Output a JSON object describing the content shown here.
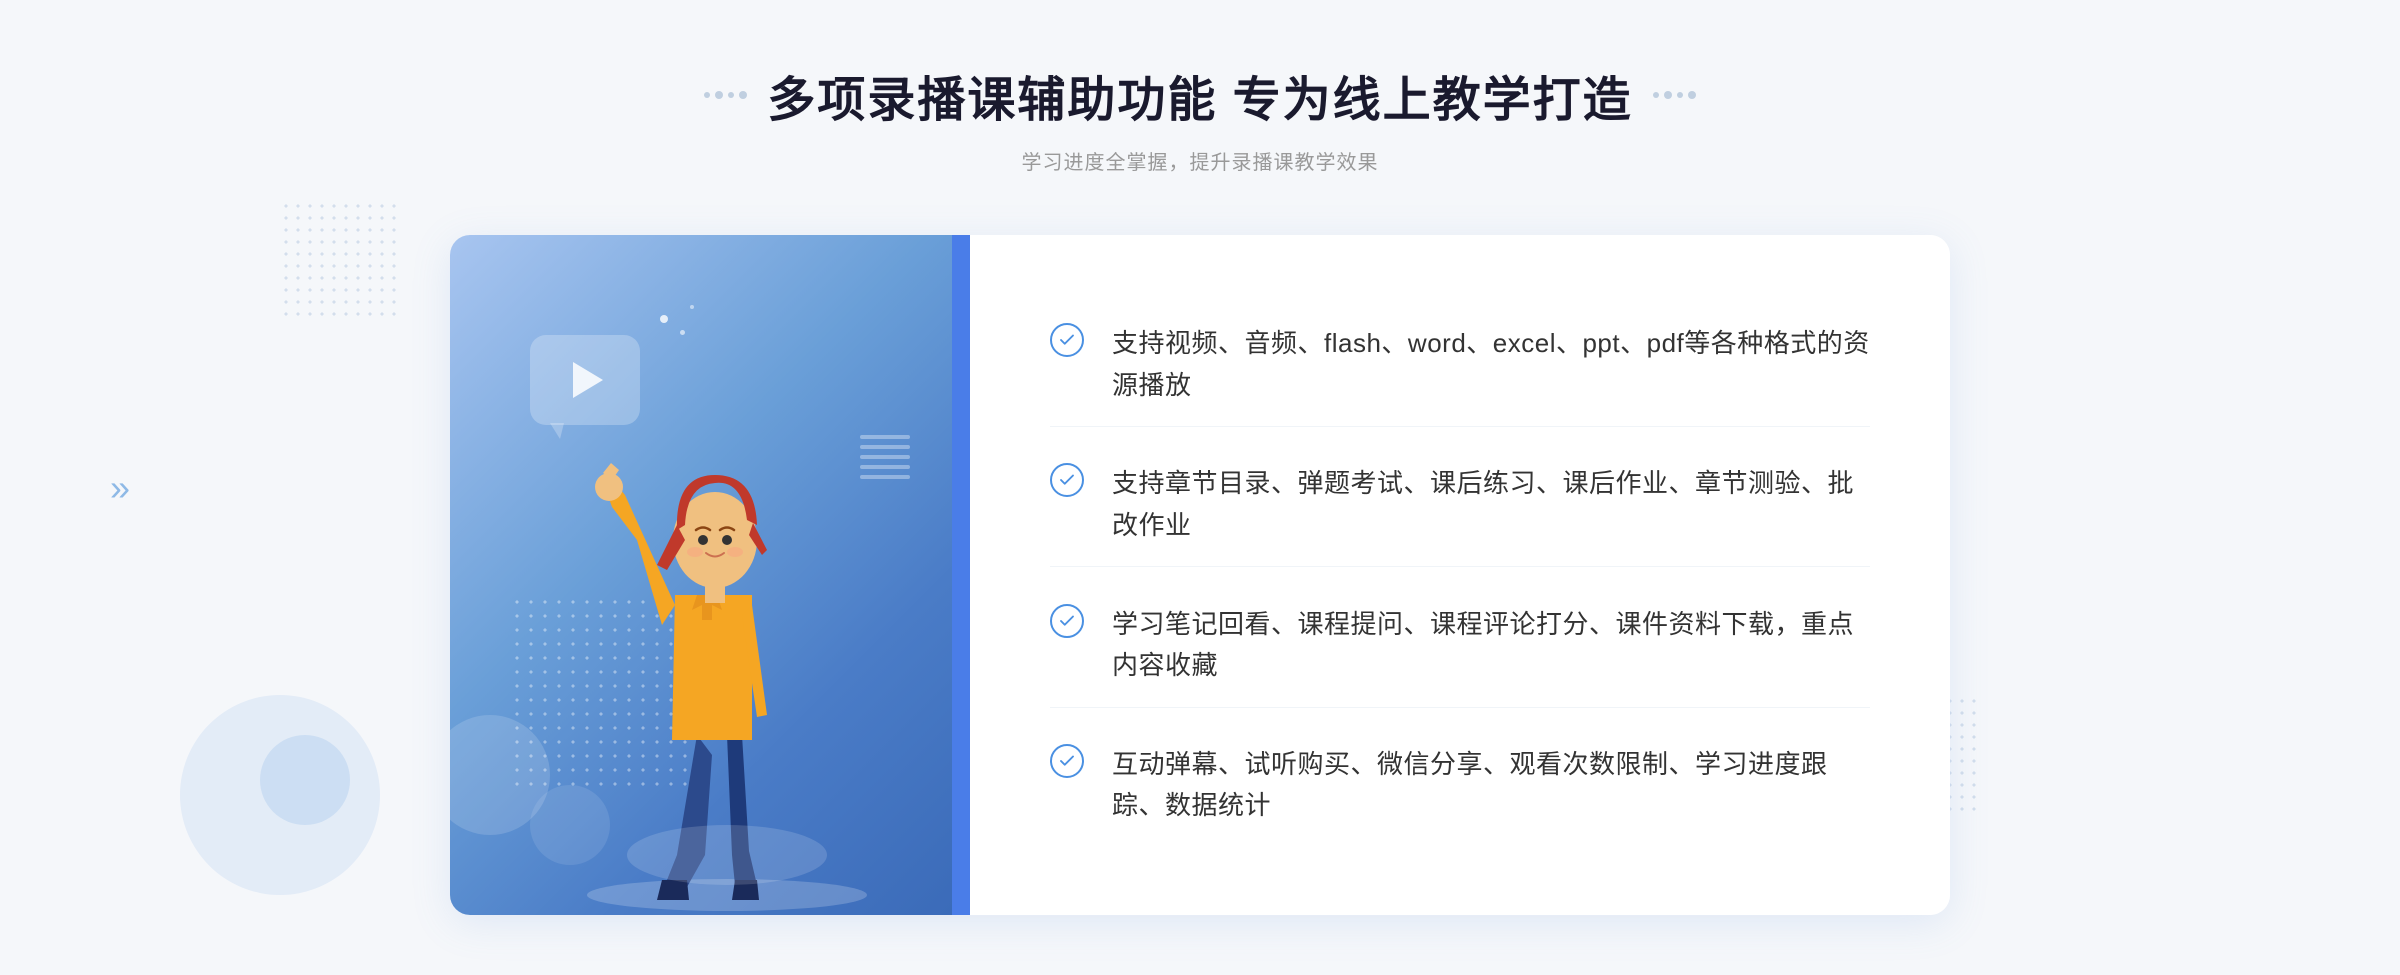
{
  "page": {
    "background_color": "#f5f7fa"
  },
  "header": {
    "title": "多项录播课辅助功能 专为线上教学打造",
    "subtitle": "学习进度全掌握，提升录播课教学效果"
  },
  "features": [
    {
      "id": 1,
      "text": "支持视频、音频、flash、word、excel、ppt、pdf等各种格式的资源播放"
    },
    {
      "id": 2,
      "text": "支持章节目录、弹题考试、课后练习、课后作业、章节测验、批改作业"
    },
    {
      "id": 3,
      "text": "学习笔记回看、课程提问、课程评论打分、课件资料下载，重点内容收藏"
    },
    {
      "id": 4,
      "text": "互动弹幕、试听购买、微信分享、观看次数限制、学习进度跟踪、数据统计"
    }
  ],
  "icons": {
    "check": "✓",
    "chevron_left": "»",
    "play": "▶"
  },
  "colors": {
    "primary_blue": "#4a90e2",
    "gradient_start": "#a8c5f0",
    "gradient_end": "#3a6ab8",
    "title_color": "#1a1a2e",
    "text_color": "#333333",
    "subtitle_color": "#999999"
  }
}
